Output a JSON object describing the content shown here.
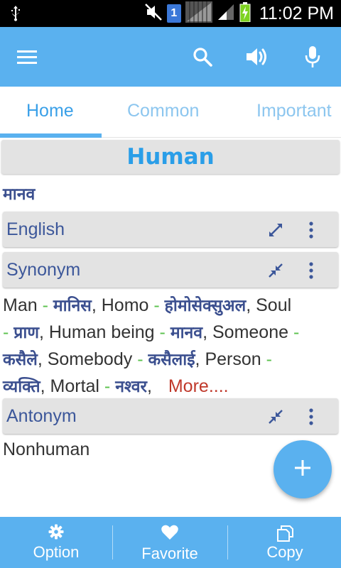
{
  "status_bar": {
    "time": "11:02 PM",
    "sim_number": "1",
    "icons": [
      "usb-icon",
      "mute-icon",
      "sim-icon",
      "no-signal-icon",
      "signal-icon",
      "battery-charging-icon"
    ]
  },
  "app_bar": {
    "icons": [
      "menu-icon",
      "search-icon",
      "speaker-icon",
      "mic-icon"
    ]
  },
  "tabs": [
    {
      "label": "Home",
      "active": true
    },
    {
      "label": "Common",
      "active": false
    },
    {
      "label": "Important",
      "active": false
    }
  ],
  "word": {
    "title": "Human",
    "translation": "मानव"
  },
  "sections": {
    "english": {
      "label": "English",
      "icons": [
        "expand-icon",
        "more-vert-icon"
      ]
    },
    "synonym": {
      "label": "Synonym",
      "icons": [
        "collapse-icon",
        "more-vert-icon"
      ]
    },
    "antonym": {
      "label": "Antonym",
      "icons": [
        "collapse-icon",
        "more-vert-icon"
      ]
    }
  },
  "synonyms": [
    {
      "en": "Man",
      "hi": "मानिस"
    },
    {
      "en": "Homo",
      "hi": "होमोसेक्सुअल"
    },
    {
      "en": "Soul",
      "hi": "प्राण"
    },
    {
      "en": "Human being",
      "hi": "मानव"
    },
    {
      "en": "Someone",
      "hi": "कसैले"
    },
    {
      "en": "Somebody",
      "hi": "कसैलाई"
    },
    {
      "en": "Person",
      "hi": "व्यक्ति"
    },
    {
      "en": "Mortal",
      "hi": "नश्वर"
    }
  ],
  "synonym_separator": " - ",
  "synonym_more": "More....",
  "antonyms": "Nonhuman",
  "bottom_bar": [
    {
      "label": "Option",
      "icon": "gear-icon"
    },
    {
      "label": "Favorite",
      "icon": "heart-icon"
    },
    {
      "label": "Copy",
      "icon": "copy-icon"
    }
  ],
  "colors": {
    "primary": "#5ab1ef",
    "tab_active": "#3aa0e8",
    "section_label": "#3c579a",
    "hindi": "#3b4f8f",
    "dash": "#5cc24e",
    "more": "#c0392b"
  }
}
